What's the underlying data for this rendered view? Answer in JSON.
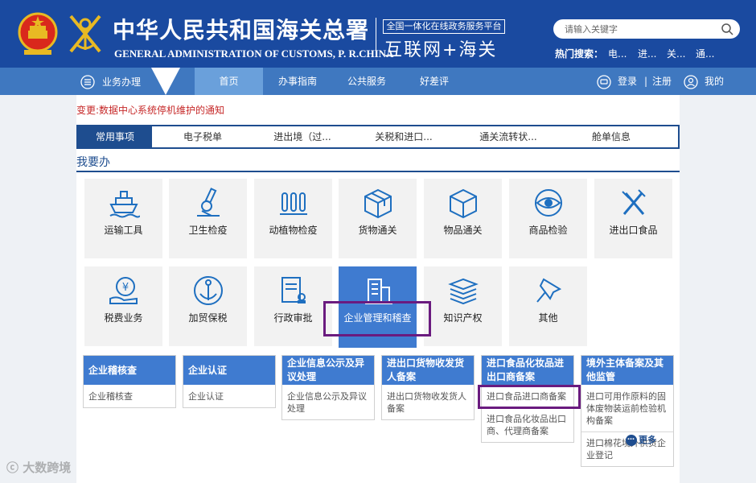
{
  "header": {
    "title_cn": "中华人民共和国海关总署",
    "title_en": "GENERAL ADMINISTRATION OF CUSTOMS, P. R.CHINA",
    "platform_tagline": "全国一体化在线政务服务平台",
    "platform_name": "互联网+海关",
    "search_placeholder": "请输入关键字",
    "hot_label": "热门搜索：",
    "hot_items": [
      "电...",
      "进...",
      "关...",
      "通..."
    ]
  },
  "nav": {
    "menu_label": "业务办理",
    "home": "首页",
    "items": [
      "办事指南",
      "公共服务",
      "好差评"
    ],
    "login": "登录",
    "separator": "|",
    "register": "注册",
    "mine": "我的"
  },
  "notice": "变更:数据中心系统停机维护的通知",
  "tabs": [
    "常用事项",
    "电子税单",
    "进出境（过...",
    "关税和进口...",
    "通关流转状...",
    "舱单信息"
  ],
  "section_title": "我要办",
  "tiles": [
    {
      "label": "运输工具",
      "icon": "ship-icon"
    },
    {
      "label": "卫生检疫",
      "icon": "microscope-icon"
    },
    {
      "label": "动植物检疫",
      "icon": "test-tubes-icon"
    },
    {
      "label": "货物通关",
      "icon": "package-icon"
    },
    {
      "label": "物品通关",
      "icon": "cube-icon"
    },
    {
      "label": "商品检验",
      "icon": "eye-icon"
    },
    {
      "label": "进出口食品",
      "icon": "fork-knife-icon"
    },
    {
      "label": "税费业务",
      "icon": "yuan-hand-icon"
    },
    {
      "label": "加贸保税",
      "icon": "anchor-icon"
    },
    {
      "label": "行政审批",
      "icon": "document-stamp-icon"
    },
    {
      "label": "企业管理和稽查",
      "icon": "buildings-icon"
    },
    {
      "label": "知识产权",
      "icon": "books-icon"
    },
    {
      "label": "其他",
      "icon": "pin-icon"
    }
  ],
  "cards": [
    {
      "head": "企业稽核查",
      "items": [
        "企业稽核查"
      ]
    },
    {
      "head": "企业认证",
      "items": [
        "企业认证"
      ]
    },
    {
      "head": "企业信息公示及异议处理",
      "items": [
        "企业信息公示及异议处理"
      ]
    },
    {
      "head": "进出口货物收发货人备案",
      "items": [
        "进出口货物收发货人备案"
      ]
    },
    {
      "head": "进口食品化妆品进出口商备案",
      "items": [
        "进口食品进口商备案",
        "进口食品化妆品出口商、代理商备案"
      ]
    },
    {
      "head": "境外主体备案及其他监管",
      "items": [
        "进口可用作原料的固体废物装运前检验机构备案",
        "进口棉花境外供货企业登记"
      ]
    }
  ],
  "more_label": "更多",
  "watermark": "大数跨境",
  "colors": {
    "header": "#1a4aa0",
    "nav": "#3f78c0",
    "accent": "#3f7bd0",
    "highlight": "#6a1b7f",
    "notice": "#c62828"
  }
}
